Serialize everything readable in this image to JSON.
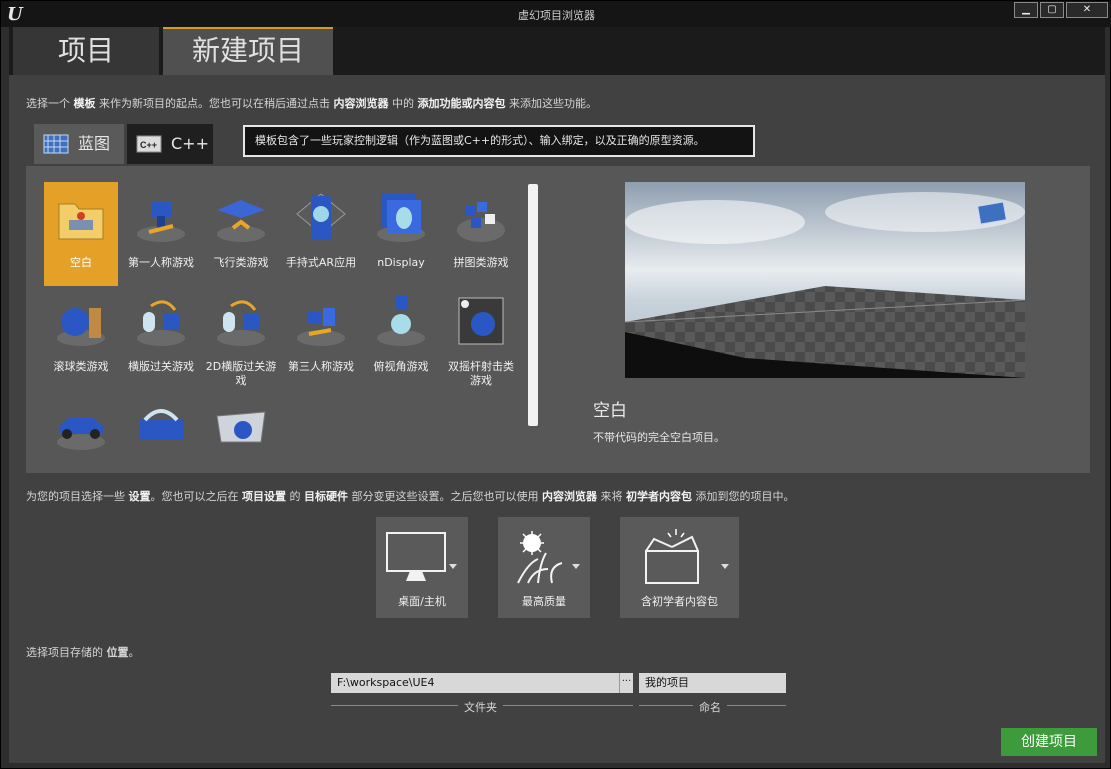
{
  "window": {
    "title": "虚幻项目浏览器",
    "controls": [
      "▁",
      "▢",
      "✕"
    ]
  },
  "tabs": [
    "项目",
    "新建项目"
  ],
  "intro": {
    "pre1": "选择一个 ",
    "b1": "模板",
    "mid1": " 来作为新项目的起点。您也可以在稍后通过点击 ",
    "b2": "内容浏览器",
    "mid2": " 中的 ",
    "b3": "添加功能或内容包",
    "post": " 来添加这些功能。"
  },
  "lang_tabs": [
    "蓝图",
    "C++"
  ],
  "tooltip": "模板包含了一些玩家控制逻辑（作为蓝图或C++的形式）、输入绑定，以及正确的原型资源。",
  "templates": [
    {
      "label": "空白",
      "icon": "folder-icon"
    },
    {
      "label": "第一人称游戏",
      "icon": "first-person-icon"
    },
    {
      "label": "飞行类游戏",
      "icon": "flying-icon"
    },
    {
      "label": "手持式AR应用",
      "icon": "handheld-ar-icon"
    },
    {
      "label": "nDisplay",
      "icon": "ndisplay-icon"
    },
    {
      "label": "拼图类游戏",
      "icon": "puzzle-icon"
    },
    {
      "label": "滚球类游戏",
      "icon": "rolling-icon"
    },
    {
      "label": "横版过关游戏",
      "icon": "side-scroller-icon"
    },
    {
      "label": "2D横版过关游戏",
      "icon": "2d-side-scroller-icon"
    },
    {
      "label": "第三人称游戏",
      "icon": "third-person-icon"
    },
    {
      "label": "俯视角游戏",
      "icon": "top-down-icon"
    },
    {
      "label": "双摇杆射击类游戏",
      "icon": "twin-stick-icon"
    },
    {
      "label": "",
      "icon": "vehicle-icon"
    },
    {
      "label": "",
      "icon": "vr-headset-icon"
    },
    {
      "label": "",
      "icon": "vehicle-advanced-icon"
    }
  ],
  "selected_template": {
    "title": "空白",
    "description": "不带代码的完全空白项目。"
  },
  "settings_intro": {
    "pre": "为您的项目选择一些 ",
    "b1": "设置",
    "m1": "。您也可以之后在 ",
    "b2": "项目设置",
    "m2": " 的 ",
    "b3": "目标硬件",
    "m3": " 部分变更这些设置。之后您也可以使用 ",
    "b4": "内容浏览器",
    "m4": " 来将 ",
    "b5": "初学者内容包",
    "post": " 添加到您的项目中。"
  },
  "settings": [
    {
      "label": "桌面/主机",
      "icon": "monitor-icon"
    },
    {
      "label": "最高质量",
      "icon": "quality-icon"
    },
    {
      "label": "含初学者内容包",
      "icon": "starter-box-icon"
    }
  ],
  "location": {
    "intro_pre": "选择项目存储的 ",
    "intro_b": "位置",
    "intro_post": "。",
    "folder": "F:\\workspace\\UE4",
    "browse": "···",
    "name": "我的项目",
    "folder_label": "文件夹",
    "name_label": "命名"
  },
  "create_button": "创建项目"
}
